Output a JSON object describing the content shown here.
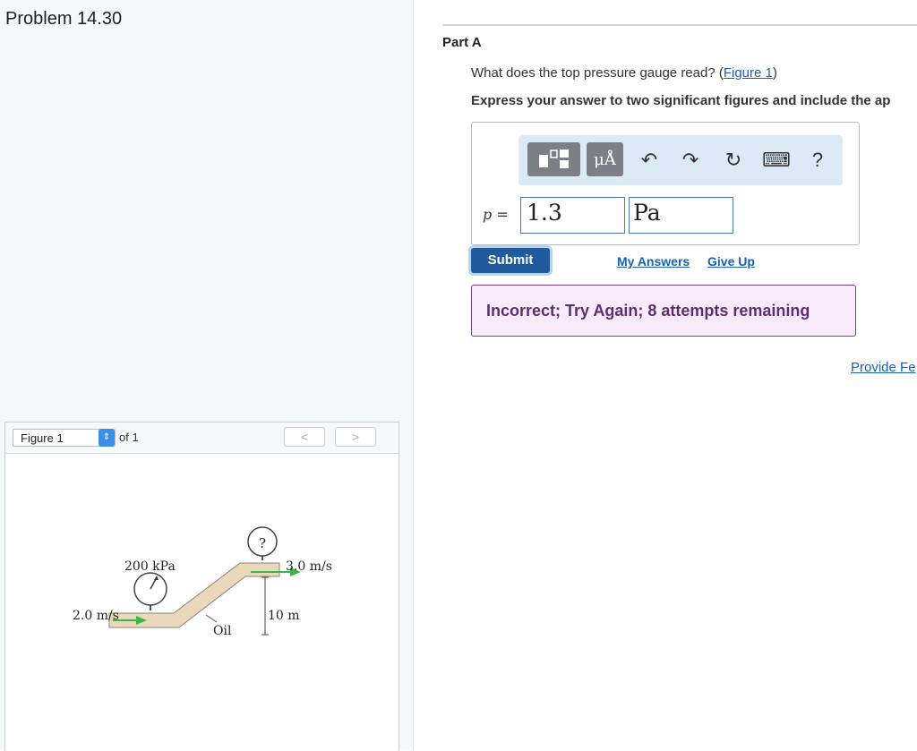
{
  "problem": {
    "title": "Problem 14.30"
  },
  "figure_panel": {
    "select_value": "Figure 1",
    "of_label": "of 1",
    "prev_symbol": "<",
    "next_symbol": ">",
    "figure": {
      "gauge_left": "200 kPa",
      "gauge_top": "?",
      "speed_in": "2.0 m/s",
      "speed_out": "3.0 m/s",
      "height": "10 m",
      "fluid": "Oil"
    }
  },
  "part": {
    "label": "Part A",
    "question_prefix": "What does the top pressure gauge read? (",
    "question_link": "Figure 1",
    "question_suffix": ")",
    "instruction": "Express your answer to two significant figures and include the ap",
    "toolbar": {
      "units_symbol": "μÅ",
      "undo_symbol": "↶",
      "redo_symbol": "↷",
      "reset_symbol": "↻",
      "keyboard_symbol": "⌨",
      "help_symbol": "?"
    },
    "variable_label": "p",
    "equals": "=",
    "answer_value": "1.3",
    "answer_unit": "Pa",
    "submit_label": "Submit",
    "my_answers_label": "My Answers",
    "give_up_label": "Give Up",
    "feedback": "Incorrect; Try Again; 8 attempts remaining",
    "provide_feedback_label": "Provide Fe"
  },
  "colors": {
    "submit": "#1f5a9c",
    "feedback_bg": "#f9ebfb",
    "feedback_text": "#5c2f73",
    "link": "#1a5fb4",
    "pipe_fill": "#e9d8bc",
    "flow_arrow": "#3bb54a"
  }
}
